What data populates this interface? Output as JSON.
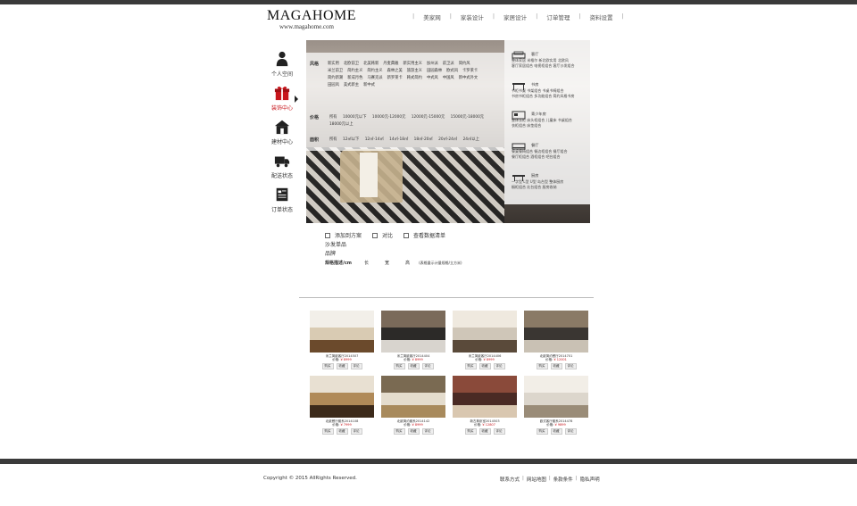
{
  "header": {
    "logo": "MAGAHOME",
    "url": "www.magahome.com",
    "nav": [
      "美家网",
      "家装设计",
      "家居设计",
      "订单管理",
      "资料设置"
    ]
  },
  "sidebar": [
    {
      "label": "个人空间",
      "icon": "person-icon"
    },
    {
      "label": "装饰中心",
      "icon": "gift-icon",
      "active": true
    },
    {
      "label": "建材中心",
      "icon": "house-icon"
    },
    {
      "label": "配送状态",
      "icon": "truck-icon"
    },
    {
      "label": "订单状态",
      "icon": "order-icon"
    }
  ],
  "filters": {
    "style": {
      "label": "风格",
      "options": [
        "新实用",
        "北欧前卫",
        "北美韩新",
        "丹麦典雅",
        "新实用主义",
        "加州派",
        "前卫派",
        "简约风",
        "米兰前卫",
        "简约主义",
        "简约主义",
        "森林之美",
        "旅游主义",
        "田园森林",
        "欧式风",
        "卡罗莱卡",
        "简约新潮",
        "新成月色",
        "马赛克派",
        "新罗莱卡",
        "韩式简约",
        "中式风",
        "中国风",
        "新中式外文",
        "田园风",
        "美式新主",
        "新中式"
      ]
    },
    "price": {
      "label": "价格",
      "options": [
        "所有",
        "10000元以下",
        "10000元-12000元",
        "12000元-15000元",
        "15000元-18000元",
        "18000元以上"
      ]
    },
    "area": {
      "label": "面积",
      "options": [
        "所有",
        "12㎡以下",
        "12㎡-14㎡",
        "14㎡-18㎡",
        "18㎡-20㎡",
        "20㎡-24㎡",
        "24㎡以上"
      ]
    }
  },
  "room_panel": [
    {
      "title": "客厅",
      "icon": "sofa-icon",
      "lines": [
        "整体家居  米格尔  新北欧实用  北欧风",
        "客厅家居组合  电视柜组合  客厅沙发组合"
      ]
    },
    {
      "title": "书房",
      "icon": "desk-icon",
      "lines": [
        "书柜书桌  书架组合  书桌书椅组合",
        "书房书柜组合  多功能组合  简约风格书房"
      ]
    },
    {
      "title": "青少年房",
      "icon": "bed-icon",
      "lines": [
        "整体衣柜  床头柜组合  儿童床  书桌组合",
        "衣柜组合  床垫组合"
      ]
    },
    {
      "title": "餐厅",
      "icon": "dining-icon",
      "lines": [
        "餐桌餐椅组合  餐边柜组合  餐厅组合",
        "餐厅柜组合  酒柜组合  吧台组合"
      ]
    },
    {
      "title": "厨房",
      "icon": "kitchen-icon",
      "lines": [
        "一字型  L型  U型  岛台型  整体厨房",
        "橱柜组合  灶台组合  厨房收纳"
      ]
    }
  ],
  "options": {
    "add_scheme": "添加到方案",
    "compare": "对比",
    "view_list": "查看数据清单"
  },
  "info": {
    "product": "沙发单品",
    "brand": "品牌",
    "spec_label": "规格描述/cm",
    "dims": [
      "长",
      "宽",
      "高"
    ],
    "note": "(表格量示计量规格/立方米)"
  },
  "products": [
    {
      "title": "米兰简欧客厅2014507",
      "price": "¥ 8999",
      "btns": [
        "购买",
        "收藏",
        "评论"
      ]
    },
    {
      "title": "米兰简欧客厅2014404",
      "price": "¥ 8999",
      "btns": [
        "购买",
        "收藏",
        "评论"
      ]
    },
    {
      "title": "米兰简欧客厅2014406",
      "price": "¥ 8999",
      "btns": [
        "购买",
        "收藏",
        "评论"
      ]
    },
    {
      "title": "北欧简约餐厅2014701",
      "price": "¥ 12001",
      "btns": [
        "购买",
        "收藏",
        "评论"
      ]
    },
    {
      "title": "北欧餐厅套系2014108",
      "price": "¥ 7999",
      "btns": [
        "购买",
        "收藏",
        "评论"
      ]
    },
    {
      "title": "北欧简约套系2014142",
      "price": "¥ 8999",
      "btns": [
        "购买",
        "收藏",
        "评论"
      ]
    },
    {
      "title": "新古典卧室2014503",
      "price": "¥ 12807",
      "btns": [
        "购买",
        "收藏",
        "评论"
      ]
    },
    {
      "title": "欧式客厅套系2014478",
      "price": "¥ 9899",
      "btns": [
        "购买",
        "收藏",
        "评论"
      ]
    }
  ],
  "footer": {
    "copyright": "Copyright © 2015 AllRights Reserved.",
    "links": [
      "联系方式",
      "网站地图",
      "条款条件",
      "隐私声明"
    ]
  }
}
